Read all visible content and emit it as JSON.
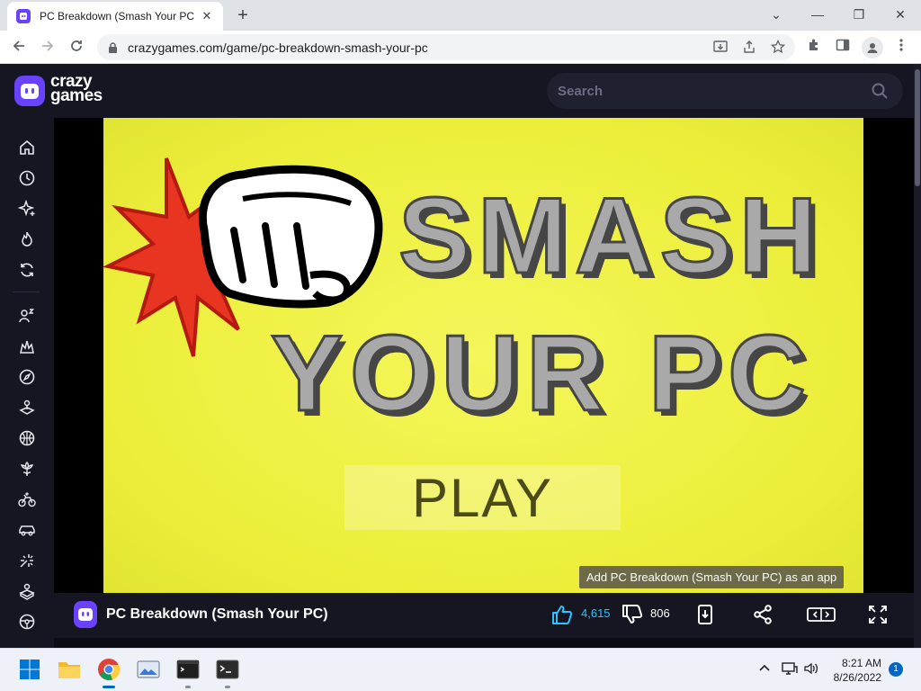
{
  "browser": {
    "tab_title": "PC Breakdown (Smash Your PC)",
    "tab_close": "✕",
    "new_tab": "+",
    "url": "crazygames.com/game/pc-breakdown-smash-your-pc",
    "window_controls": {
      "minimize": "—",
      "maximize": "❐",
      "close": "✕",
      "tab_list": "⌄"
    }
  },
  "site": {
    "logo_line1": "crazy",
    "logo_line2": "games",
    "search_placeholder": "Search"
  },
  "sidebar": {
    "items": [
      "home-icon",
      "clock-icon",
      "sparkle-icon",
      "fire-icon",
      "refresh-icon",
      "multiplayer-icon",
      "action-icon",
      "compass-icon",
      "joystick-icon",
      "basketball-icon",
      "flower-icon",
      "bicycle-icon",
      "car-icon",
      "shooting-icon",
      "puzzle-icon",
      "steering-icon"
    ]
  },
  "game": {
    "title_line1": "SMASH",
    "title_line2": "YOUR PC",
    "play_label": "PLAY",
    "tooltip": "Add PC Breakdown (Smash Your PC) as an app"
  },
  "game_bar": {
    "name": "PC Breakdown (Smash Your PC)",
    "likes": "4,615",
    "dislikes": "806"
  },
  "taskbar": {
    "time": "8:21 AM",
    "date": "8/26/2022",
    "notification_count": "1"
  },
  "colors": {
    "brand": "#6842ff",
    "like": "#29c4ff",
    "game_bg": "#ecee3a",
    "title_fill": "#a9a9a9"
  }
}
